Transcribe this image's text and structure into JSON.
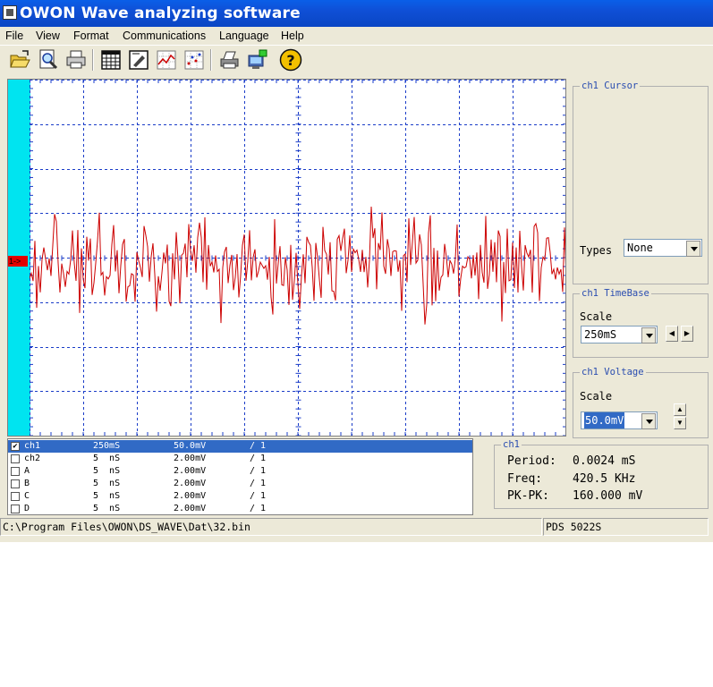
{
  "window": {
    "title": "OWON Wave analyzing software"
  },
  "menu": [
    "File",
    "View",
    "Format",
    "Communications",
    "Language",
    "Help"
  ],
  "toolbar": {
    "buttons": [
      "open-file-icon",
      "preview-icon",
      "print-icon",
      "table-icon",
      "edit-icon",
      "chart-line-icon",
      "chart-dots-icon",
      "printer-setup-icon",
      "transfer-icon",
      "help-icon"
    ]
  },
  "scope": {
    "marker_label": "1->",
    "colors": {
      "background": "#ffffff",
      "grid": "#1a3cc8",
      "trace": "#cc0000",
      "strip": "#00e4f0"
    }
  },
  "cursor_panel": {
    "title": "ch1 Cursor",
    "types_label": "Types",
    "types_value": "None"
  },
  "timebase_panel": {
    "title": "ch1 TimeBase",
    "scale_label": "Scale",
    "scale_value": "250mS"
  },
  "voltage_panel": {
    "title": "ch1 Voltage",
    "scale_label": "Scale",
    "scale_value": "50.0mV"
  },
  "channels": [
    {
      "checked": "✔",
      "name": "ch1",
      "time": "250mS",
      "volt": "50.0mV",
      "ratio": "/ 1",
      "selected": true
    },
    {
      "checked": "",
      "name": "ch2",
      "time": "5  nS",
      "volt": "2.00mV",
      "ratio": "/ 1"
    },
    {
      "checked": "",
      "name": "A",
      "time": "5  nS",
      "volt": "2.00mV",
      "ratio": "/ 1"
    },
    {
      "checked": "",
      "name": "B",
      "time": "5  nS",
      "volt": "2.00mV",
      "ratio": "/ 1"
    },
    {
      "checked": "",
      "name": "C",
      "time": "5  nS",
      "volt": "2.00mV",
      "ratio": "/ 1"
    },
    {
      "checked": "",
      "name": "D",
      "time": "5  nS",
      "volt": "2.00mV",
      "ratio": "/ 1"
    }
  ],
  "measure": {
    "title": "ch1",
    "period_label": "Period:",
    "period_value": "0.0024 mS",
    "freq_label": "Freq:",
    "freq_value": "420.5 KHz",
    "pkpk_label": "PK-PK:",
    "pkpk_value": "160.000 mV"
  },
  "status": {
    "path": "C:\\Program Files\\OWON\\DS_WAVE\\Dat\\32.bin",
    "device": "PDS 5022S"
  }
}
